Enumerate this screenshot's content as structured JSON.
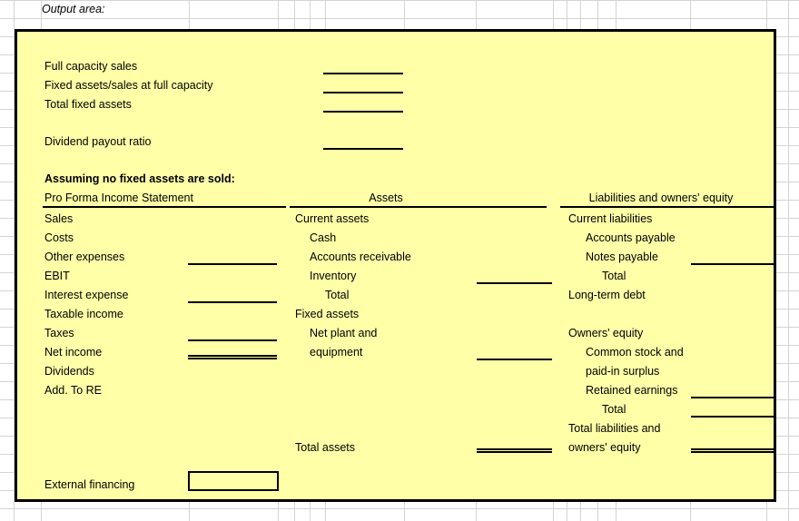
{
  "app": {
    "type": "spreadsheet",
    "panel_fill": "#ffffa8",
    "panel_border": "#000000",
    "grid_color": "#d4d4d4"
  },
  "sheet": {
    "output_area_label": "Output area:"
  },
  "panel": {
    "top_section": {
      "rows": [
        {
          "label": "Full capacity sales",
          "value": "",
          "rule": "single"
        },
        {
          "label": "Fixed assets/sales at full capacity",
          "value": "",
          "rule": "single"
        },
        {
          "label": "Total fixed assets",
          "value": "",
          "rule": "single"
        },
        {
          "label": "Dividend payout ratio",
          "value": "",
          "rule": "single"
        }
      ]
    },
    "assumption_heading": "Assuming no fixed assets are sold:",
    "columns": {
      "income_statement": {
        "header": "Pro Forma Income Statement",
        "rows": [
          {
            "label": "Sales",
            "value": "",
            "rule": "none"
          },
          {
            "label": "Costs",
            "value": "",
            "rule": "none"
          },
          {
            "label": "Other expenses",
            "value": "",
            "rule": "single"
          },
          {
            "label": "EBIT",
            "value": "",
            "rule": "none"
          },
          {
            "label": "Interest expense",
            "value": "",
            "rule": "single"
          },
          {
            "label": "Taxable income",
            "value": "",
            "rule": "none"
          },
          {
            "label": "Taxes",
            "value": "",
            "rule": "single"
          },
          {
            "label": "Net income",
            "value": "",
            "rule": "double"
          },
          {
            "label": "Dividends",
            "value": "",
            "rule": "none"
          },
          {
            "label": "Add. To RE",
            "value": "",
            "rule": "none"
          }
        ],
        "footer": {
          "label": "External financing",
          "value": ""
        }
      },
      "assets": {
        "header": "Assets",
        "rows": [
          {
            "label": "Current assets",
            "indent": 0,
            "value": "",
            "rule": "none"
          },
          {
            "label": "Cash",
            "indent": 1,
            "value": "",
            "rule": "none"
          },
          {
            "label": "Accounts receivable",
            "indent": 1,
            "value": "",
            "rule": "none"
          },
          {
            "label": "Inventory",
            "indent": 1,
            "value": "",
            "rule": "single"
          },
          {
            "label": "Total",
            "indent": 2,
            "value": "",
            "rule": "none"
          },
          {
            "label": "Fixed assets",
            "indent": 0,
            "value": "",
            "rule": "none"
          },
          {
            "label": "Net plant and",
            "indent": 1,
            "value": "",
            "rule": "none"
          },
          {
            "label": "equipment",
            "indent": 1,
            "value": "",
            "rule": "single"
          }
        ],
        "total": {
          "label": "Total assets",
          "indent": 0,
          "value": "",
          "rule": "double"
        }
      },
      "liabilities": {
        "header": "Liabilities and owners' equity",
        "rows": [
          {
            "label": "Current liabilities",
            "indent": 0,
            "value": "",
            "rule": "none"
          },
          {
            "label": "Accounts payable",
            "indent": 1,
            "value": "",
            "rule": "none"
          },
          {
            "label": "Notes payable",
            "indent": 1,
            "value": "",
            "rule": "single"
          },
          {
            "label": "Total",
            "indent": 2,
            "value": "",
            "rule": "none"
          },
          {
            "label": "Long-term debt",
            "indent": 0,
            "value": "",
            "rule": "none"
          },
          {
            "label": "Owners' equity",
            "indent": 0,
            "value": "",
            "rule": "none"
          },
          {
            "label": "Common stock and",
            "indent": 1,
            "value": "",
            "rule": "none"
          },
          {
            "label": "paid-in surplus",
            "indent": 1,
            "value": "",
            "rule": "none"
          },
          {
            "label": "Retained earnings",
            "indent": 1,
            "value": "",
            "rule": "single"
          },
          {
            "label": "Total",
            "indent": 2,
            "value": "",
            "rule": "single"
          },
          {
            "label": "Total liabilities and",
            "indent": 0,
            "value": "",
            "rule": "none"
          },
          {
            "label": "owners' equity",
            "indent": 0,
            "value": "",
            "rule": "double"
          }
        ]
      }
    }
  }
}
